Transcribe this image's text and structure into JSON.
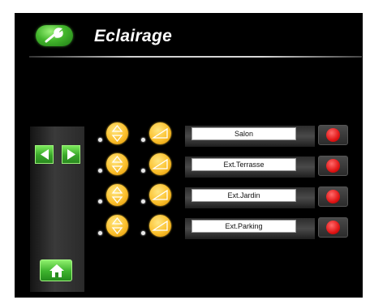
{
  "header": {
    "title": "Eclairage",
    "tool_icon": "wrench-icon"
  },
  "navigation": {
    "prev_icon": "arrow-left-icon",
    "next_icon": "arrow-right-icon",
    "home_icon": "home-icon"
  },
  "lights": [
    {
      "label": "Salon"
    },
    {
      "label": "Ext.Terrasse"
    },
    {
      "label": "Ext.Jardin"
    },
    {
      "label": "Ext.Parking"
    }
  ],
  "colors": {
    "accent_green": "#43b62c",
    "knob_yellow": "#fbc02d",
    "record_red": "#e01515",
    "background": "#000000"
  }
}
